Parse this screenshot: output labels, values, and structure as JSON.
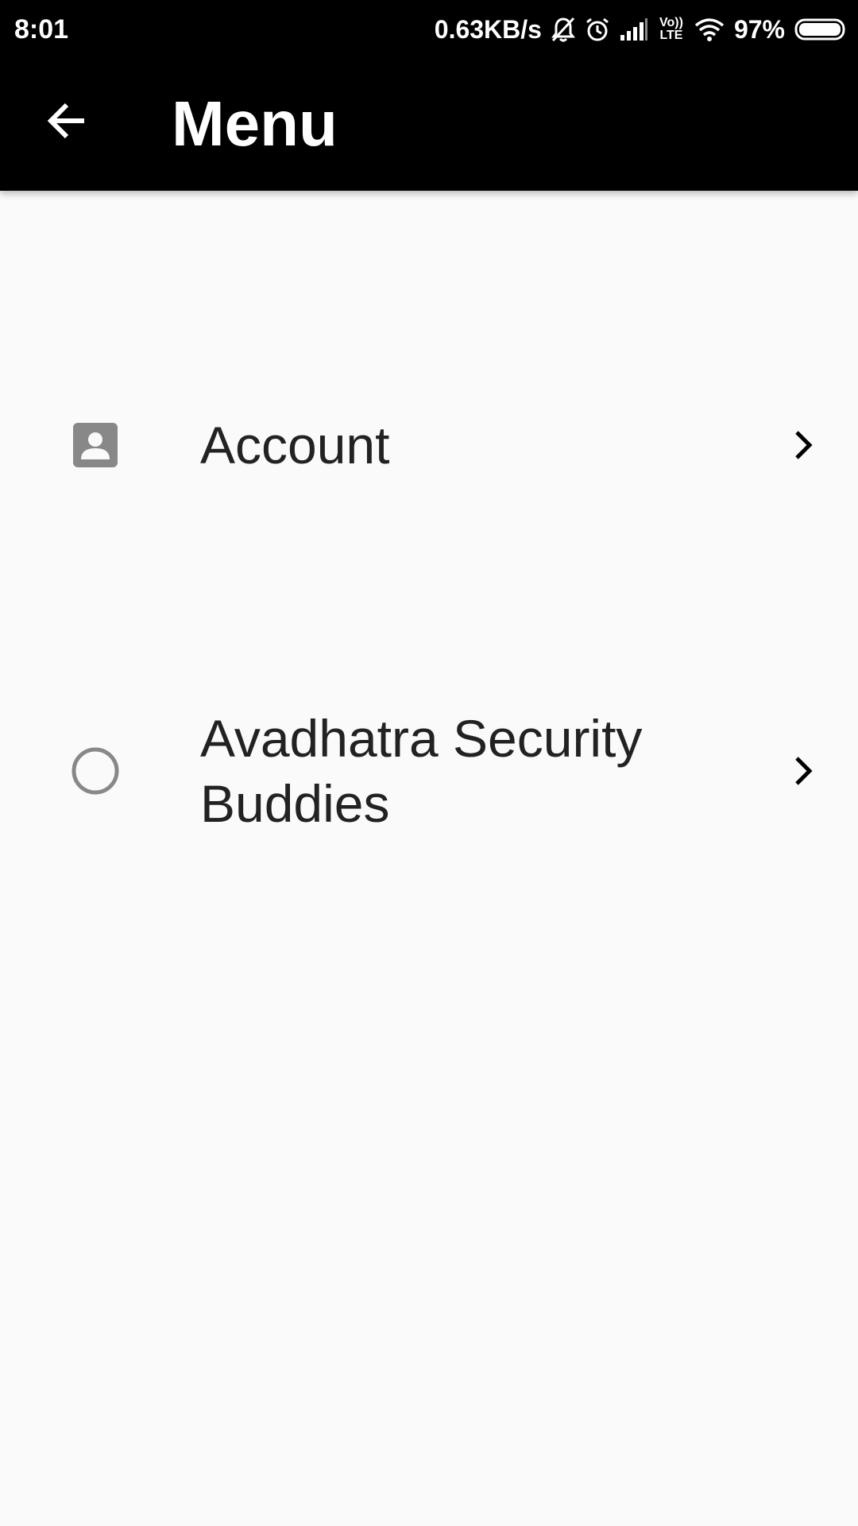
{
  "status_bar": {
    "time": "8:01",
    "net_speed": "0.63KB/s",
    "lte_label_top": "Vo))",
    "lte_label_bottom": "LTE",
    "battery": "97%",
    "icons": [
      "mute-icon",
      "alarm-icon",
      "signal-icon",
      "volte-icon",
      "wifi-icon",
      "battery-icon"
    ]
  },
  "app_bar": {
    "back_icon": "arrow-back-icon",
    "title": "Menu"
  },
  "menu": {
    "items": [
      {
        "label": "Account",
        "icon": "account-box-icon",
        "trailing_icon": "chevron-right-icon"
      },
      {
        "label": "Avadhatra Security Buddies",
        "icon": "circle-outline-icon",
        "trailing_icon": "chevron-right-icon"
      }
    ]
  },
  "colors": {
    "bar_background": "#000000",
    "page_background": "#fafafa",
    "icon_gray": "#888888",
    "text_dark": "#222222"
  }
}
